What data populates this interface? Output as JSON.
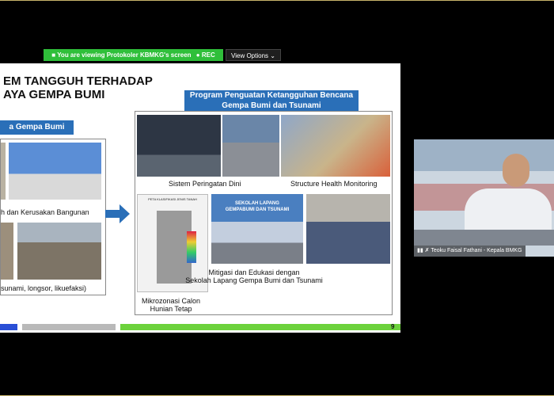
{
  "banner": {
    "text": "You are viewing Protokoler KBMKG's screen",
    "rec": "REC"
  },
  "view_options": "View Options",
  "slide": {
    "title_line1": "EM TANGGUH TERHADAP",
    "title_line2": "AYA GEMPA BUMI",
    "left_label": "a Gempa Bumi",
    "left_cap1": "h dan Kerusakan Bangunan",
    "left_cap2": "sunami, longsor, likuefaksi)",
    "right_label_line1": "Program Penguatan Ketangguhan Bencana",
    "right_label_line2": "Gempa Bumi dan Tsunami",
    "cap_sistem": "Sistem Peringatan Dini",
    "cap_shm": "Structure Health Monitoring",
    "cap_mitigasi1": "Mitigasi dan Edukasi dengan",
    "cap_mitigasi2": "Sekolah Lapang Gempa Bumi dan Tsunami",
    "cap_mikro1": "Mikrozonasi Calon",
    "cap_mikro2": "Hunian Tetap",
    "poster_title1": "SEKOLAH LAPANG",
    "poster_title2": "GEMPABUMI DAN TSUNAMI",
    "map_title": "PETA KLASIFIKASI JENIS TANAH",
    "page_number": "9"
  },
  "video": {
    "name": "Teoku Faisal Fathani - Kepala BMKG"
  },
  "colors": {
    "banner_green": "#2fbf3a",
    "slide_blue": "#2a6fb8",
    "bar_green": "#6cd23c"
  }
}
